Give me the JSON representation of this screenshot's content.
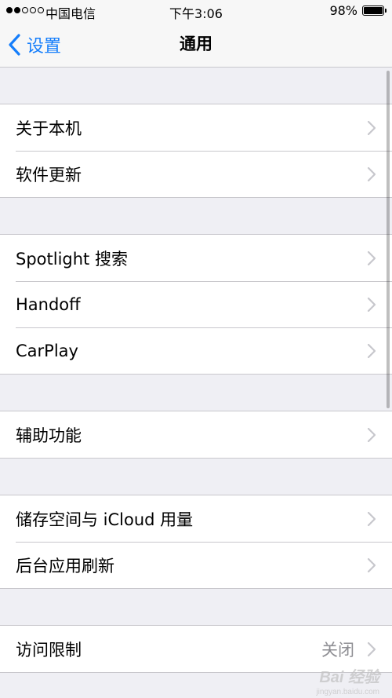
{
  "status_bar": {
    "carrier": "中国电信",
    "time": "下午3:06",
    "battery": "98%",
    "signal_filled": 2,
    "signal_total": 5
  },
  "nav": {
    "back_label": "设置",
    "title": "通用",
    "accent_color": "#157efb"
  },
  "groups": [
    {
      "rows": [
        {
          "label": "关于本机",
          "value": ""
        },
        {
          "label": "软件更新",
          "value": ""
        }
      ]
    },
    {
      "rows": [
        {
          "label": "Spotlight 搜索",
          "value": ""
        },
        {
          "label": "Handoff",
          "value": ""
        },
        {
          "label": "CarPlay",
          "value": ""
        }
      ]
    },
    {
      "rows": [
        {
          "label": "辅助功能",
          "value": ""
        }
      ]
    },
    {
      "rows": [
        {
          "label": "储存空间与 iCloud 用量",
          "value": ""
        },
        {
          "label": "后台应用刷新",
          "value": ""
        }
      ]
    },
    {
      "rows": [
        {
          "label": "访问限制",
          "value": "关闭"
        }
      ]
    }
  ],
  "watermark": {
    "text": "Bai 经验",
    "sub": "jingyan.baidu.com"
  }
}
